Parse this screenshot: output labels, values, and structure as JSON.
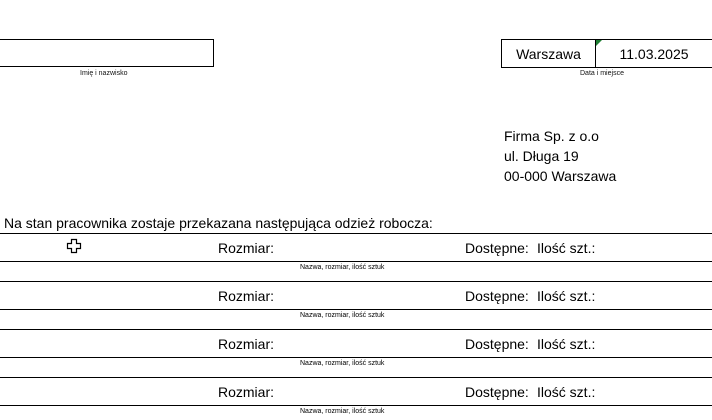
{
  "header": {
    "name_label": "Imię i nazwisko",
    "city": "Warszawa",
    "date": "11.03.2025",
    "date_place_label": "Data i miejsce"
  },
  "company": {
    "line1": "Firma Sp. z o.o",
    "line2": "ul. Długa 19",
    "line3": "00-000 Warszawa"
  },
  "intro_text": "Na stan pracownika zostaje przekazana następująca odzież robocza:",
  "rows": [
    {
      "size_label": "Rozmiar:",
      "available_label": "Dostępne:",
      "qty_label": "Ilość szt.:",
      "sub_label": "Nazwa, rozmiar, ilość sztuk"
    },
    {
      "size_label": "Rozmiar:",
      "available_label": "Dostępne:",
      "qty_label": "Ilość szt.:",
      "sub_label": "Nazwa, rozmiar, ilość sztuk"
    },
    {
      "size_label": "Rozmiar:",
      "available_label": "Dostępne:",
      "qty_label": "Ilość szt.:",
      "sub_label": "Nazwa, rozmiar, ilość sztuk"
    },
    {
      "size_label": "Rozmiar:",
      "available_label": "Dostępne:",
      "qty_label": "Ilość szt.:",
      "sub_label": "Nazwa, rozmiar, ilość sztuk"
    }
  ],
  "icons": {
    "cursor": "cell-cursor-icon"
  }
}
